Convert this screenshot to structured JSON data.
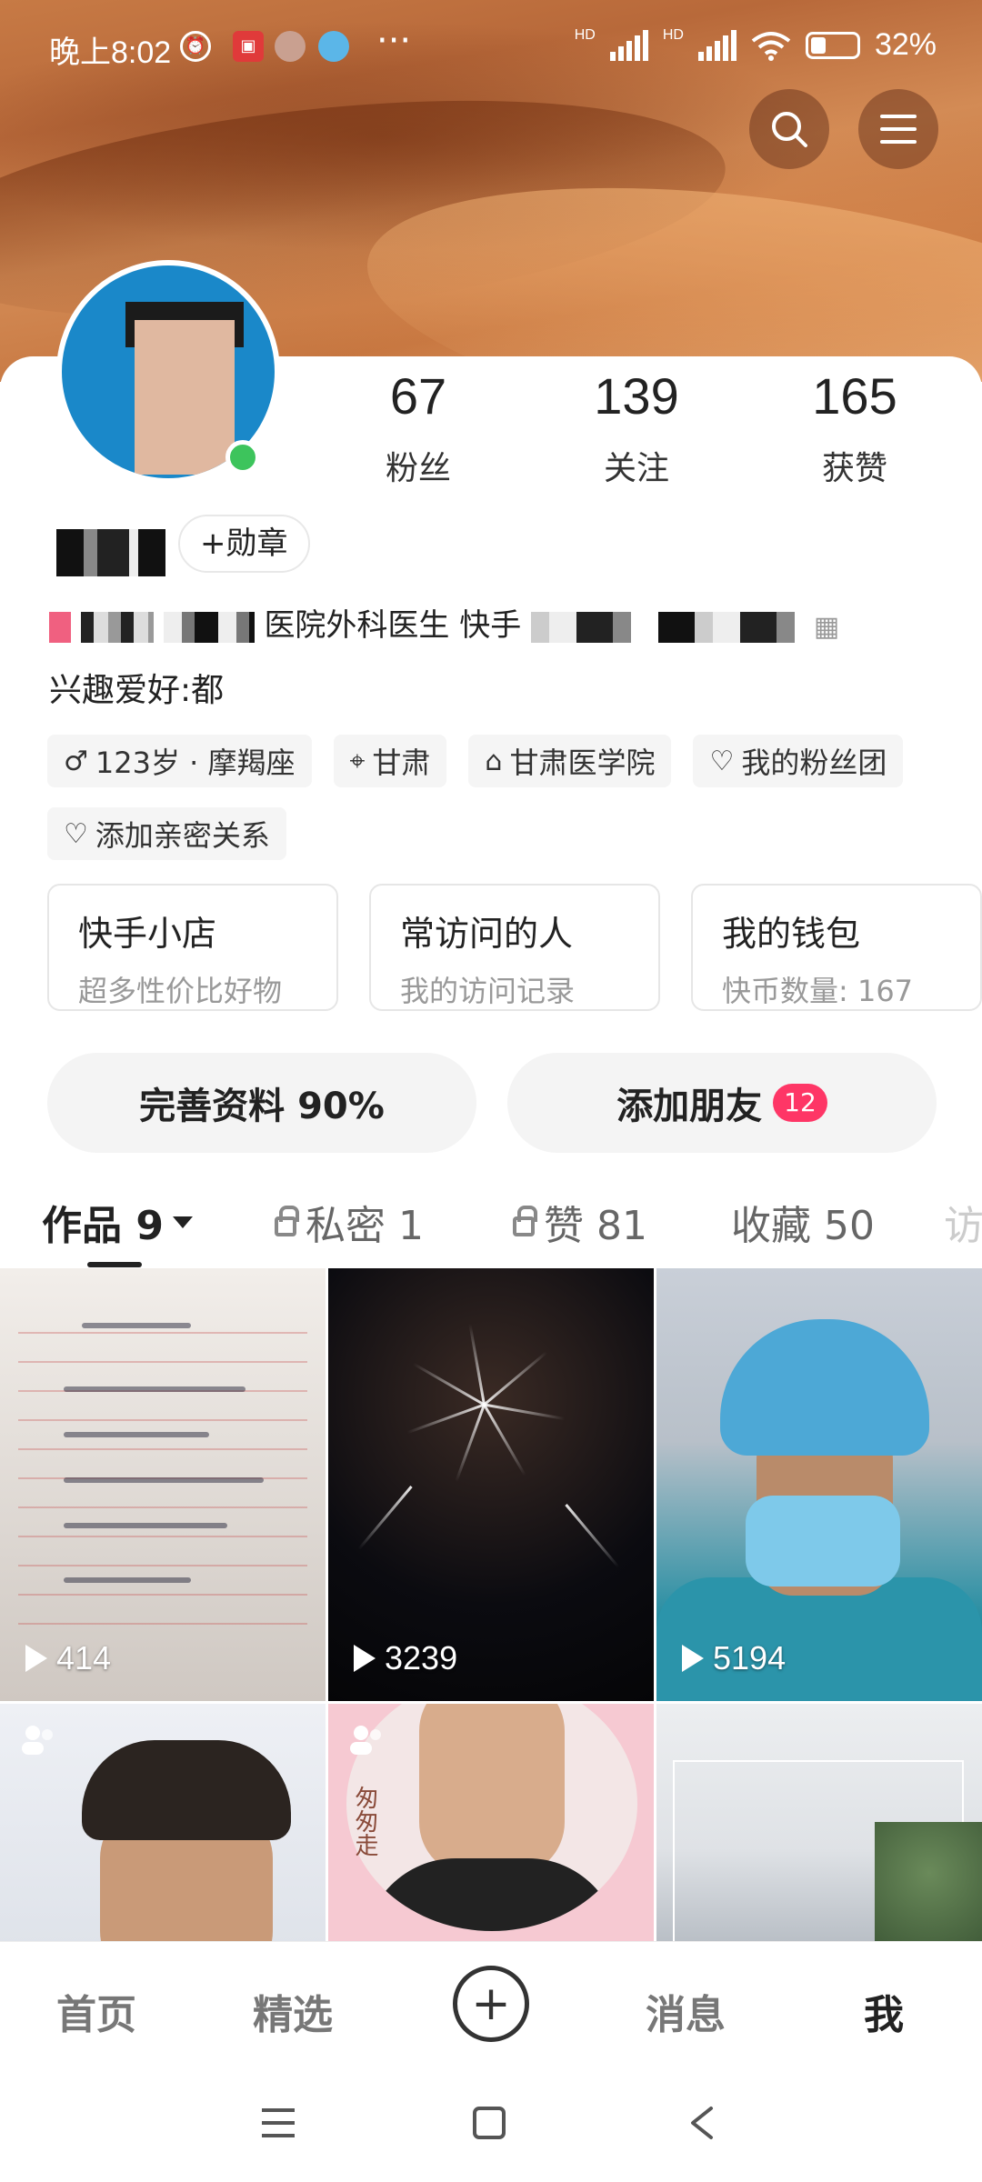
{
  "status_bar": {
    "time": "晚上8:02",
    "more": "···",
    "network1": "HD",
    "network2": "HD",
    "battery": "32%"
  },
  "profile": {
    "stats": [
      {
        "value": "67",
        "label": "粉丝"
      },
      {
        "value": "139",
        "label": "关注"
      },
      {
        "value": "165",
        "label": "获赞"
      }
    ],
    "badge_button": "+勋章",
    "bio_line": "医院外科医生   快手",
    "hobby": "兴趣爱好:都",
    "tags": [
      {
        "icon": "male-icon",
        "glyph": "♂",
        "text": "123岁 · 摩羯座"
      },
      {
        "icon": "location-icon",
        "glyph": "⌖",
        "text": "甘肃"
      },
      {
        "icon": "school-icon",
        "glyph": "⌂",
        "text": "甘肃医学院"
      },
      {
        "icon": "heart-icon",
        "glyph": "♡",
        "text": "我的粉丝团"
      },
      {
        "icon": "link-heart-icon",
        "glyph": "♡",
        "text": "添加亲密关系"
      }
    ]
  },
  "quick_cards": [
    {
      "title": "快手小店",
      "subtitle": "超多性价比好物"
    },
    {
      "title": "常访问的人",
      "subtitle": "我的访问记录"
    },
    {
      "title": "我的钱包",
      "subtitle": "快币数量: 167"
    }
  ],
  "actions": {
    "complete_profile": "完善资料 90%",
    "add_friend": "添加朋友",
    "add_friend_count": "12"
  },
  "tabs": [
    {
      "label": "作品 9",
      "active": true
    },
    {
      "label": "私密 1",
      "locked": true
    },
    {
      "label": "赞 81",
      "locked": true
    },
    {
      "label": "收藏 50"
    },
    {
      "label": "访"
    }
  ],
  "videos": [
    {
      "plays": "414"
    },
    {
      "plays": "3239"
    },
    {
      "plays": "5194"
    }
  ],
  "video_texts": {
    "vertical": "匆匆走"
  },
  "bottom_nav": {
    "home": "首页",
    "featured": "精选",
    "create": "+",
    "messages": "消息",
    "me": "我"
  },
  "colors": {
    "accent_red": "#fe3666",
    "online_green": "#3dc45c"
  }
}
